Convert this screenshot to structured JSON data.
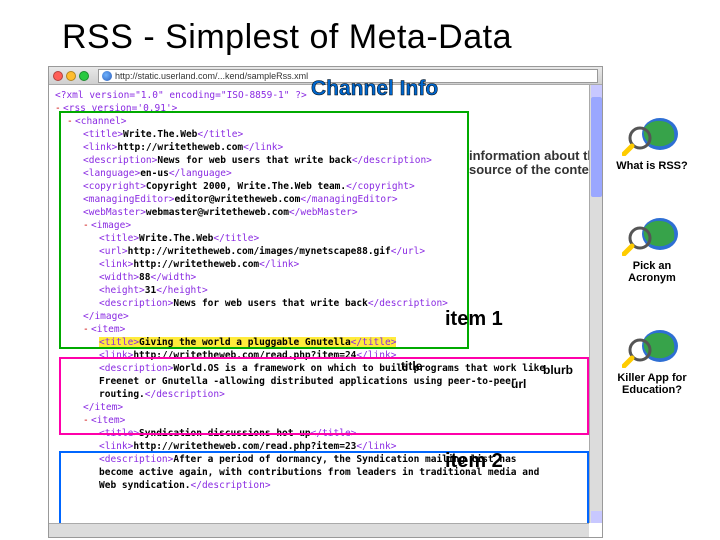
{
  "title": "RSS - Simplest of Meta-Data",
  "browser": {
    "url": "http://static.userland.com/...kend/sampleRss.xml"
  },
  "xml": {
    "decl": "<?xml version=\"1.0\" encoding=\"ISO-8859-1\" ?>",
    "rss_open": "<rss version='0.91'>",
    "channel_open": "<channel>",
    "title_tag": "<title>",
    "title_val": "Write.The.Web",
    "title_end": "</title>",
    "link_tag": "<link>",
    "link_val": "http://writetheweb.com",
    "link_end": "</link>",
    "desc_tag": "<description>",
    "desc_val": "News for web users that write back",
    "desc_end": "</description>",
    "lang_tag": "<language>",
    "lang_val": "en-us",
    "lang_end": "</language>",
    "copy_tag": "<copyright>",
    "copy_val": "Copyright 2000, Write.The.Web team.",
    "copy_end": "</copyright>",
    "me_tag": "<managingEditor>",
    "me_val": "editor@writetheweb.com",
    "me_end": "</managingEditor>",
    "wm_tag": "<webMaster>",
    "wm_val": "webmaster@writetheweb.com",
    "wm_end": "</webMaster>",
    "img_open": "<image>",
    "img_title_tag": "<title>",
    "img_title_val": "Write.The.Web",
    "img_title_end": "</title>",
    "img_url_tag": "<url>",
    "img_url_val": "http://writetheweb.com/images/mynetscape88.gif",
    "img_url_end": "</url>",
    "img_link_tag": "<link>",
    "img_link_val": "http://writetheweb.com",
    "img_link_end": "</link>",
    "img_w_tag": "<width>",
    "img_w_val": "88",
    "img_w_end": "</width>",
    "img_h_tag": "<height>",
    "img_h_val": "31",
    "img_h_end": "</height>",
    "img_d_tag": "<description>",
    "img_d_val": "News for web users that write back",
    "img_d_end": "</description>",
    "img_close": "</image>",
    "item1_open": "<item>",
    "item1_t_tag": "<title>",
    "item1_t_val": "Giving the world a pluggable Gnutella",
    "item1_t_end": "</title>",
    "item1_l_tag": "<link>",
    "item1_l_val": "http://writetheweb.com/read.php?item=24",
    "item1_l_end": "</link>",
    "item1_d_tag": "<description>",
    "item1_d_val": "World.OS is a framework on which to build programs that work like Freenet or Gnutella -allowing distributed applications using peer-to-peer routing.",
    "item1_d_end": "</description>",
    "item1_close": "</item>",
    "item2_open": "<item>",
    "item2_t_tag": "<title>",
    "item2_t_val": "Syndication discussions hot up",
    "item2_t_end": "</title>",
    "item2_l_tag": "<link>",
    "item2_l_val": "http://writetheweb.com/read.php?item=23",
    "item2_l_end": "</link>",
    "item2_d_tag": "<description>",
    "item2_d_val": "After a period of dormancy, the Syndication mailing list has become active again, with contributions from leaders in traditional media and Web syndication.",
    "item2_d_end": "</description>"
  },
  "labels": {
    "channel": "Channel Info",
    "info": "information about the source of the content",
    "item1": "item 1",
    "item2": "item 2",
    "title": "title",
    "url": "url",
    "blurb": "blurb"
  },
  "sidebar": {
    "a": "What is RSS?",
    "b": "Pick an Acronym",
    "c": "Killer App for Education?"
  }
}
